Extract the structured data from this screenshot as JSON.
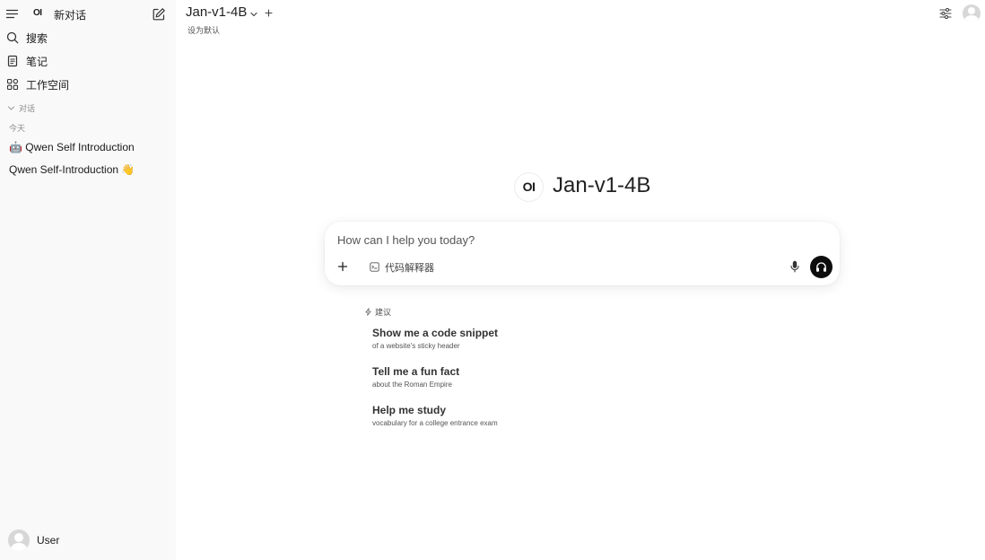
{
  "sidebar": {
    "logo": "OI",
    "new_chat_label": "新对话",
    "nav": [
      {
        "label": "搜索",
        "icon": "search-icon"
      },
      {
        "label": "笔记",
        "icon": "notes-icon"
      },
      {
        "label": "工作空间",
        "icon": "workspace-icon"
      }
    ],
    "section_label": "对话",
    "group_label": "今天",
    "chats": [
      {
        "emoji": "🤖",
        "title": "Qwen Self Introduction"
      },
      {
        "title": "Qwen Self-Introduction",
        "emoji": "👋"
      }
    ],
    "user_name": "User"
  },
  "header": {
    "model_name": "Jan-v1-4B",
    "set_default_label": "设为默认"
  },
  "main": {
    "logo": "OI",
    "title": "Jan-v1-4B",
    "composer": {
      "placeholder": "How can I help you today?",
      "tool_label": "代码解释器"
    },
    "suggestions_label": "建议",
    "suggestions": [
      {
        "title": "Show me a code snippet",
        "subtitle": "of a website's sticky header"
      },
      {
        "title": "Tell me a fun fact",
        "subtitle": "about the Roman Empire"
      },
      {
        "title": "Help me study",
        "subtitle": "vocabulary for a college entrance exam"
      }
    ]
  }
}
